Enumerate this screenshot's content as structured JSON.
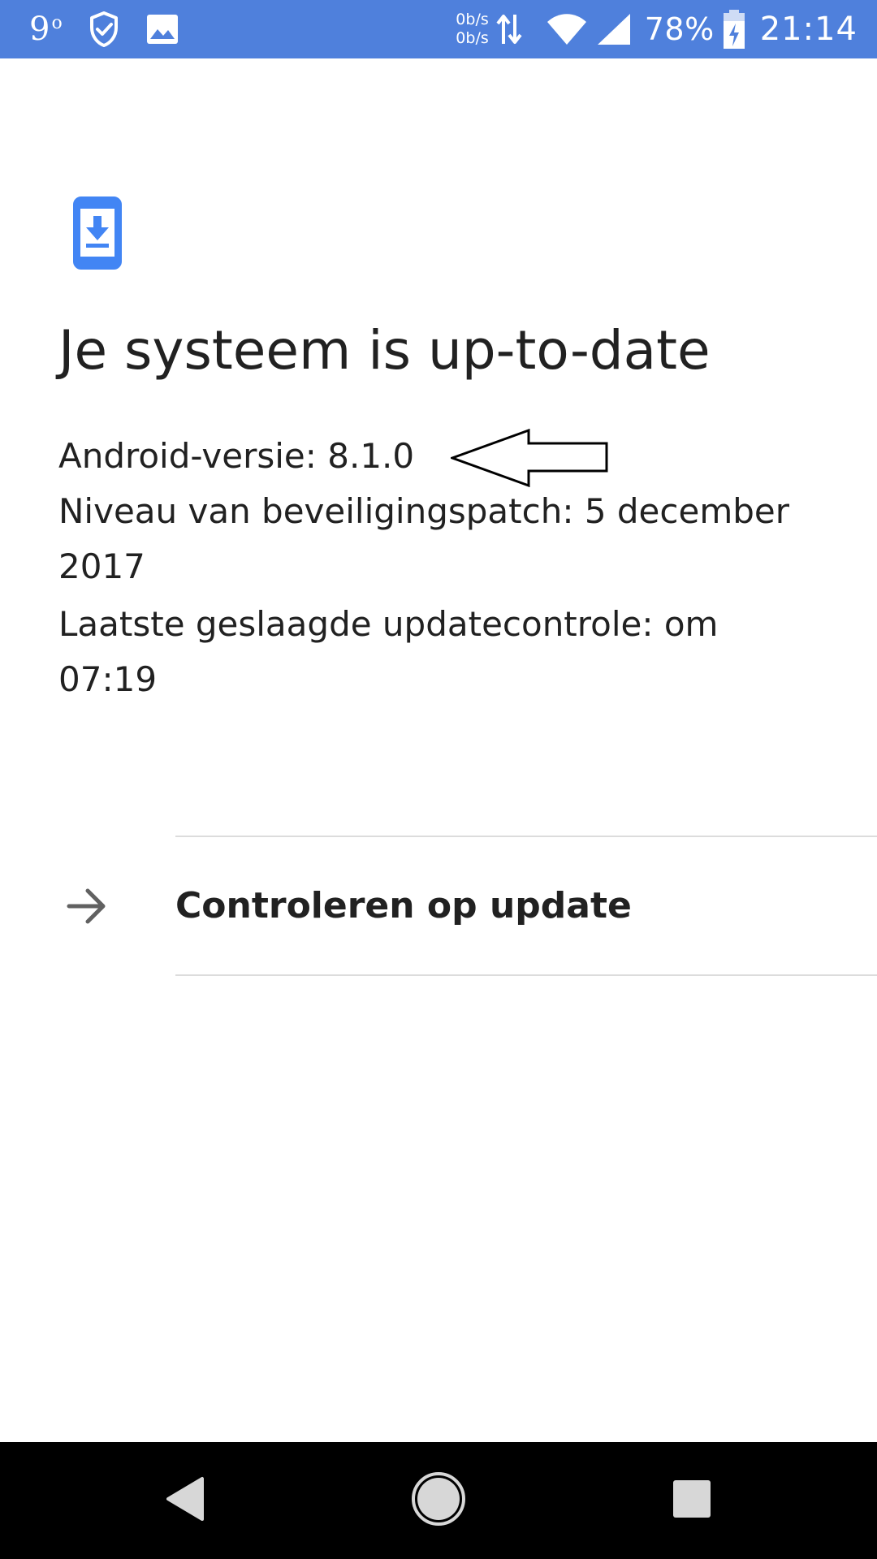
{
  "status_bar": {
    "weather_temp": "9",
    "weather_unit": "o",
    "net_up": "0b/s",
    "net_down": "0b/s",
    "battery_percent": "78%",
    "time": "21:14",
    "icons": [
      "weather-icon",
      "shield-check-icon",
      "image-icon",
      "data-transfer-icon",
      "wifi-icon",
      "signal-icon",
      "battery-charging-icon"
    ],
    "background_color": "#4f80dc"
  },
  "content": {
    "icon": "phone-download-icon",
    "icon_color": "#4285f4",
    "title": "Je systeem is up-to-date",
    "android_version": "Android-versie: 8.1.0",
    "security_patch": "Niveau van beveiligingspatch: 5 december 2017",
    "last_check": "Laatste geslaagde updatecontrole: om 07:19",
    "annotation": "left-arrow-outline-icon"
  },
  "action": {
    "icon": "arrow-right-icon",
    "label": "Controleren op update"
  },
  "nav_bar": {
    "back": "back-triangle-icon",
    "home": "home-circle-icon",
    "recents": "recents-square-icon"
  }
}
